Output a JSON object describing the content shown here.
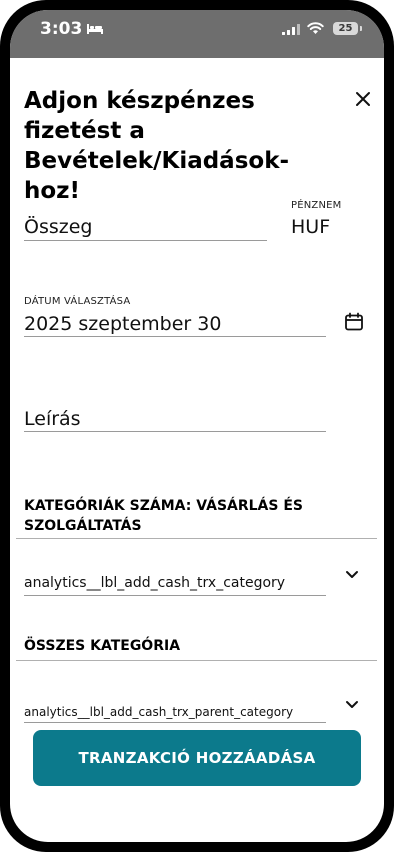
{
  "status_bar": {
    "time": "3:03",
    "battery": "25"
  },
  "dialog": {
    "title": "Adjon készpénzes fizetést a Bevételek/Kiadások-hoz!",
    "amount": {
      "value": "Összeg"
    },
    "currency": {
      "label": "PÉNZNEM",
      "value": "HUF"
    },
    "date": {
      "label": "DÁTUM VÁLASZTÁSA",
      "value": "2025 szeptember 30"
    },
    "description": {
      "value": "Leírás"
    },
    "category_section": {
      "label": "KATEGÓRIÁK SZÁMA: VÁSÁRLÁS ÉS SZOLGÁLTATÁS",
      "selected": "analytics__lbl_add_cash_trx_category"
    },
    "parent_category_section": {
      "label": "ÖSSZES KATEGÓRIA",
      "selected": "analytics__lbl_add_cash_trx_parent_category"
    },
    "submit_label": "TRANZAKCIÓ HOZZÁADÁSA"
  },
  "colors": {
    "accent": "#0c7a8c",
    "status_bar": "#6e6e6e"
  },
  "icons": [
    "bed-icon",
    "signal-icon",
    "wifi-icon",
    "battery-icon",
    "close-icon",
    "calendar-icon",
    "chevron-down-icon"
  ]
}
